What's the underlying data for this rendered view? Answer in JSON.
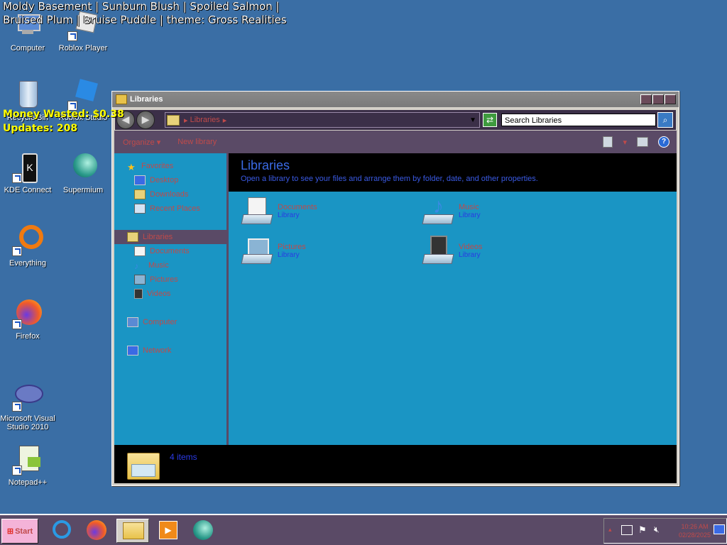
{
  "overlay": {
    "theme_line": "Moldy Basement | Sunburn Blush | Spoiled Salmon | Bruised Plum | Bruise Puddle | theme: Gross Realities",
    "money": "Money Wasted: $0.38",
    "updates": "Updates: 208"
  },
  "desktop_icons": [
    {
      "label": "Computer"
    },
    {
      "label": "Roblox Player"
    },
    {
      "label": "Recycle Bin"
    },
    {
      "label": "Roblox Studio"
    },
    {
      "label": "KDE Connect"
    },
    {
      "label": "Supermium"
    },
    {
      "label": "Everything"
    },
    {
      "label": "Firefox"
    },
    {
      "label": "Microsoft Visual Studio 2010"
    },
    {
      "label": "Notepad++"
    }
  ],
  "window": {
    "title": "Libraries",
    "address": "Libraries",
    "search_placeholder": "Search Libraries",
    "toolbar": {
      "organize": "Organize ▾",
      "new_library": "New library"
    },
    "nav": {
      "favorites": "Favorites",
      "desktop": "Desktop",
      "downloads": "Downloads",
      "recent": "Recent Places",
      "libraries": "Libraries",
      "documents": "Documents",
      "music": "Music",
      "pictures": "Pictures",
      "videos": "Videos",
      "computer": "Computer",
      "network": "Network"
    },
    "header": {
      "title": "Libraries",
      "subtitle": "Open a library to see your files and arrange them by folder, date, and other properties."
    },
    "libraries": [
      {
        "name": "Documents",
        "type": "Library"
      },
      {
        "name": "Music",
        "type": "Library"
      },
      {
        "name": "Pictures",
        "type": "Library"
      },
      {
        "name": "Videos",
        "type": "Library"
      }
    ],
    "status": "4 items"
  },
  "taskbar": {
    "start": "Start",
    "time": "10:26 AM",
    "date": "02/28/2025"
  }
}
